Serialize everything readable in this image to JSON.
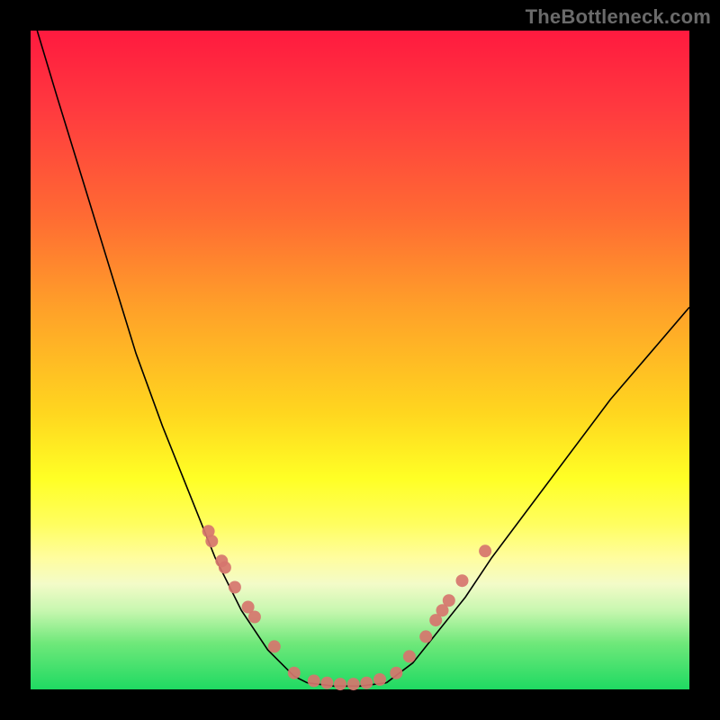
{
  "watermark": "TheBottleneck.com",
  "chart_data": {
    "type": "line",
    "title": "",
    "xlabel": "",
    "ylabel": "",
    "xlim": [
      0,
      1
    ],
    "ylim": [
      0,
      1
    ],
    "grid": false,
    "background": "rainbow-vertical-red-to-green",
    "curve_left": {
      "x": [
        0.01,
        0.04,
        0.08,
        0.12,
        0.16,
        0.2,
        0.24,
        0.28,
        0.32,
        0.36,
        0.4,
        0.42
      ],
      "y": [
        1.0,
        0.9,
        0.77,
        0.64,
        0.51,
        0.4,
        0.3,
        0.2,
        0.12,
        0.06,
        0.02,
        0.01
      ]
    },
    "curve_valley": {
      "x": [
        0.42,
        0.46,
        0.5,
        0.54
      ],
      "y": [
        0.01,
        0.005,
        0.005,
        0.01
      ]
    },
    "curve_right": {
      "x": [
        0.54,
        0.58,
        0.62,
        0.66,
        0.7,
        0.76,
        0.82,
        0.88,
        0.94,
        1.0
      ],
      "y": [
        0.01,
        0.04,
        0.09,
        0.14,
        0.2,
        0.28,
        0.36,
        0.44,
        0.51,
        0.58
      ]
    },
    "markers_left": {
      "x": [
        0.27,
        0.275,
        0.29,
        0.295,
        0.31,
        0.33,
        0.34,
        0.37,
        0.4
      ],
      "y": [
        0.24,
        0.225,
        0.195,
        0.185,
        0.155,
        0.125,
        0.11,
        0.065,
        0.025
      ]
    },
    "markers_valley": {
      "x": [
        0.43,
        0.45,
        0.47,
        0.49,
        0.51,
        0.53
      ],
      "y": [
        0.013,
        0.01,
        0.008,
        0.008,
        0.01,
        0.015
      ]
    },
    "markers_right": {
      "x": [
        0.555,
        0.575,
        0.6,
        0.615,
        0.625,
        0.635,
        0.655,
        0.69
      ],
      "y": [
        0.025,
        0.05,
        0.08,
        0.105,
        0.12,
        0.135,
        0.165,
        0.21
      ]
    },
    "marker_color": "#d6756e",
    "marker_radius_px": 7
  }
}
